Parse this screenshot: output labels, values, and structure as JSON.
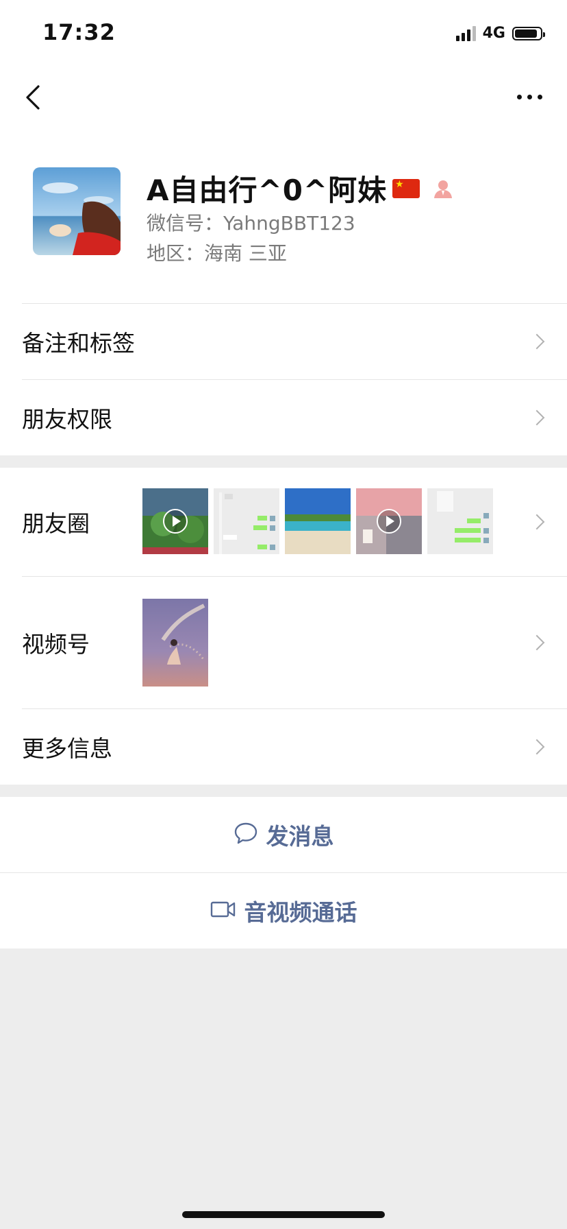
{
  "status": {
    "time": "17:32",
    "network": "4G"
  },
  "profile": {
    "name": "A自由行^0^阿妹",
    "wechat_id": "微信号：YahngBBT123",
    "region": "地区：海南 三亚"
  },
  "menu": {
    "remarks": "备注和标签",
    "permissions": "朋友权限",
    "moments": "朋友圈",
    "channels": "视频号",
    "more_info": "更多信息"
  },
  "actions": {
    "message": "发消息",
    "call": "音视频通话"
  },
  "colors": {
    "link": "#576b95",
    "background": "#ededed"
  },
  "icons": [
    "back-icon",
    "more-icon",
    "flag-icon",
    "person-icon",
    "chevron-right-icon",
    "chat-bubble-icon",
    "video-camera-icon",
    "play-icon"
  ]
}
